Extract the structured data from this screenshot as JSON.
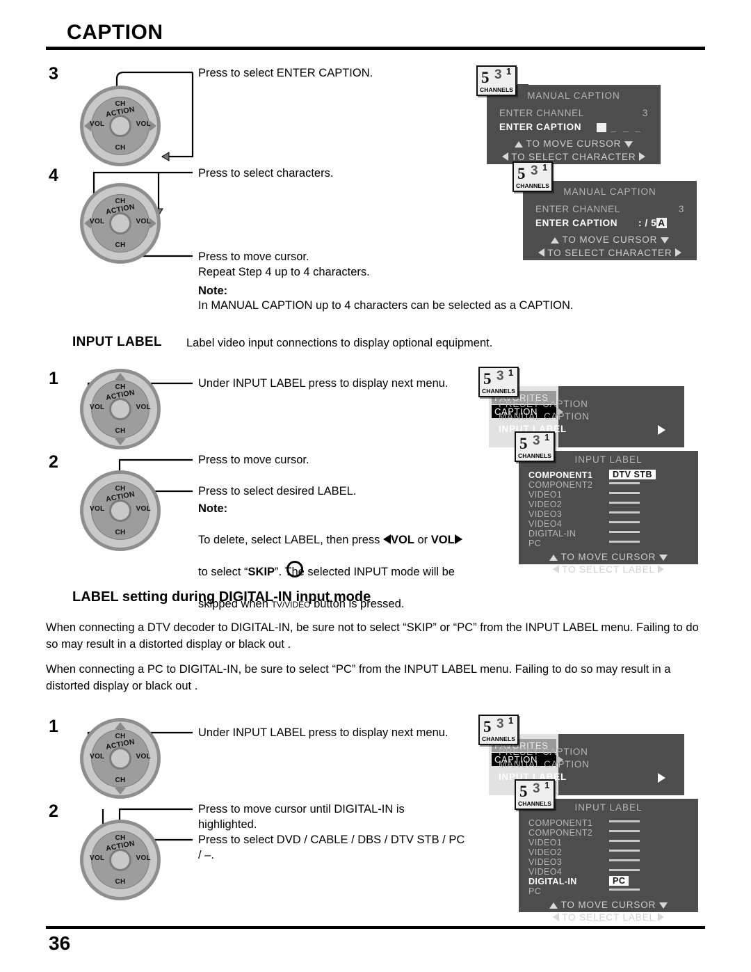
{
  "page": {
    "title": "CAPTION",
    "number": "36"
  },
  "steps": {
    "s3": "3",
    "s4": "4",
    "il1": "1",
    "il2": "2",
    "dg1": "1",
    "dg2": "2"
  },
  "instructions": {
    "step3": "Press to select ENTER CAPTION.",
    "step4": "Press to select characters.",
    "step4_move": "Press to move cursor.",
    "step4_repeat": "Repeat Step 4 up to 4 characters.",
    "note_label": "Note:",
    "note_manual": "In MANUAL CAPTION up to 4 characters can be selected as a CAPTION.",
    "input_label_heading": "INPUT LABEL",
    "input_label_desc": "Label video input connections to display optional equipment.",
    "il_step1": "Under INPUT LABEL  press to display next menu.",
    "il_step2_move": "Press to move cursor.",
    "il_step2_select": "Press to select desired LABEL.",
    "il_note_1a": "To delete, select LABEL, then press ",
    "il_note_vol1": "VOL",
    "il_note_or": " or ",
    "il_note_vol2": "VOL",
    "il_note_1b": "to select “",
    "il_note_skip": "SKIP",
    "il_note_1c": "”. The selected INPUT mode will be",
    "il_note_2": "skipped when ",
    "il_note_tvvideo": "TV/VIDEO",
    "il_note_2b": " button is pressed.",
    "dg_step1": "Under INPUT LABEL  press to display next menu.",
    "dg_step2_a": "Press to move cursor until DIGITAL-IN is",
    "dg_step2_b": "highlighted.",
    "dg_step2_c": "Press to select  DVD / CABLE / DBS / DTV STB / PC",
    "dg_step2_d": "/ –."
  },
  "digital_section": {
    "heading": "LABEL setting during DIGITAL-IN input mode",
    "para1": "When connecting a DTV decoder to DIGITAL-IN, be sure not to select “SKIP” or “PC” from the INPUT LABEL menu. Failing to do so may result in a distorted display or black out .",
    "para2": "When connecting a PC to DIGITAL-IN, be sure to select “PC” from the INPUT LABEL menu. Failing to do so may result in a distorted display or black out ."
  },
  "dial": {
    "ch_top": "CH",
    "ch_bottom": "CH",
    "vol_left": "VOL",
    "vol_right": "VOL",
    "action": "ACTION"
  },
  "badge": {
    "main": "5",
    "sup": "3",
    "sup2": "1",
    "caption": "CHANNELS"
  },
  "osd_manual_caption_1": {
    "title": "MANUAL  CAPTION",
    "row1_label": "ENTER  CHANNEL",
    "row1_value": "3",
    "row2_label": "ENTER  CAPTION",
    "row2_value": "█ _ _ _",
    "hint1": "TO  MOVE  CURSOR",
    "hint2": "TO  SELECT  CHARACTER"
  },
  "osd_manual_caption_2": {
    "title": "MANUAL  CAPTION",
    "row1_label": "ENTER  CHANNEL",
    "row1_value": "3",
    "row2_label": "ENTER  CAPTION",
    "row2_value": ": / 5",
    "row2_cursor": "A",
    "hint1": "TO  MOVE  CURSOR",
    "hint2": "TO  SELECT  CHARACTER"
  },
  "osd_caption_menu": {
    "left_items": [
      "FAVORITES",
      "CAPTION"
    ],
    "right_items": [
      "PRESET  CAPTION",
      "MANUAL  CAPTION",
      "INPUT  LABEL"
    ],
    "selected_right": "INPUT  LABEL"
  },
  "osd_input_label_1": {
    "title": "INPUT  LABEL",
    "rows": [
      {
        "label": "COMPONENT1",
        "value": "DTV STB",
        "selected": true
      },
      {
        "label": "COMPONENT2",
        "value": "",
        "selected": false
      },
      {
        "label": "VIDEO1",
        "value": "",
        "selected": false
      },
      {
        "label": "VIDEO2",
        "value": "",
        "selected": false
      },
      {
        "label": "VIDEO3",
        "value": "",
        "selected": false
      },
      {
        "label": "VIDEO4",
        "value": "",
        "selected": false
      },
      {
        "label": "DIGITAL-IN",
        "value": "",
        "selected": false
      },
      {
        "label": "PC",
        "value": "",
        "selected": false
      }
    ],
    "hint1": "TO  MOVE  CURSOR",
    "hint2": "TO  SELECT  LABEL"
  },
  "osd_input_label_2": {
    "title": "INPUT  LABEL",
    "rows": [
      {
        "label": "COMPONENT1",
        "value": "",
        "selected": false
      },
      {
        "label": "COMPONENT2",
        "value": "",
        "selected": false
      },
      {
        "label": "VIDEO1",
        "value": "",
        "selected": false
      },
      {
        "label": "VIDEO2",
        "value": "",
        "selected": false
      },
      {
        "label": "VIDEO3",
        "value": "",
        "selected": false
      },
      {
        "label": "VIDEO4",
        "value": "",
        "selected": false
      },
      {
        "label": "DIGITAL-IN",
        "value": "PC",
        "selected": true
      },
      {
        "label": "PC",
        "value": "",
        "selected": false
      }
    ],
    "hint1": "TO  MOVE  CURSOR",
    "hint2": "TO  SELECT  LABEL"
  },
  "colors": {
    "osd_bg": "#4d4d4d",
    "menu_left_bg": "#e2e2e2",
    "selected_bg": "#000000",
    "dial_outer": "#8e8e8e"
  }
}
